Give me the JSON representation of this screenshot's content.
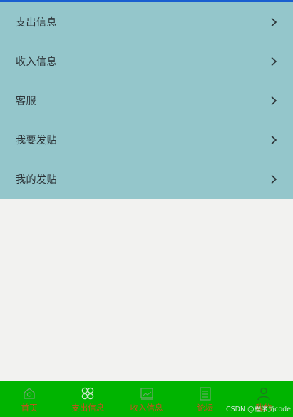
{
  "menu": {
    "items": [
      {
        "label": "支出信息"
      },
      {
        "label": "收入信息"
      },
      {
        "label": "客服"
      },
      {
        "label": "我要发贴"
      },
      {
        "label": "我的发贴"
      }
    ]
  },
  "tabbar": {
    "tabs": [
      {
        "label": "首页",
        "icon": "home-icon"
      },
      {
        "label": "支出信息",
        "icon": "grid-icon"
      },
      {
        "label": "收入信息",
        "icon": "image-icon"
      },
      {
        "label": "论坛",
        "icon": "list-icon"
      },
      {
        "label": "我的",
        "icon": "user-icon"
      }
    ]
  },
  "watermark": "CSDN @程序员code",
  "colors": {
    "accent": "#1a5fd0",
    "menu_bg": "#94c6cb",
    "tabbar_bg": "#00b400",
    "tab_label": "#c8501e",
    "page_bg": "#f2f2f0"
  }
}
